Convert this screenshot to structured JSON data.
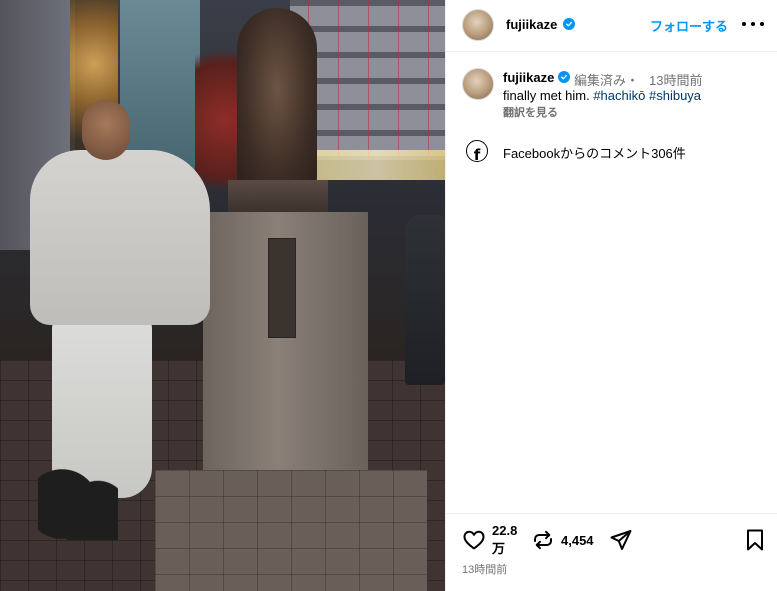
{
  "post": {
    "username": "fujiikaze",
    "verified": true,
    "follow_label": "フォローする",
    "more_label": "more-options"
  },
  "caption": {
    "username": "fujiikaze",
    "edited_label": "編集済み・",
    "time": "13時間前",
    "text": "finally met him.",
    "hashtags": [
      "#hachikō",
      "#shibuya"
    ],
    "translate_label": "翻訳を見る"
  },
  "facebook": {
    "comments_text": "Facebookからのコメント306件",
    "icon": "facebook-icon"
  },
  "actions": {
    "likes_number": "22.8",
    "likes_unit": "万",
    "reposts": "4,454",
    "time": "13時間前",
    "icons": [
      "heart-icon",
      "repost-icon",
      "share-icon",
      "bookmark-icon"
    ]
  },
  "colors": {
    "accent": "#0095f6",
    "secondary_text": "#737373",
    "hashtag": "#00376b"
  }
}
